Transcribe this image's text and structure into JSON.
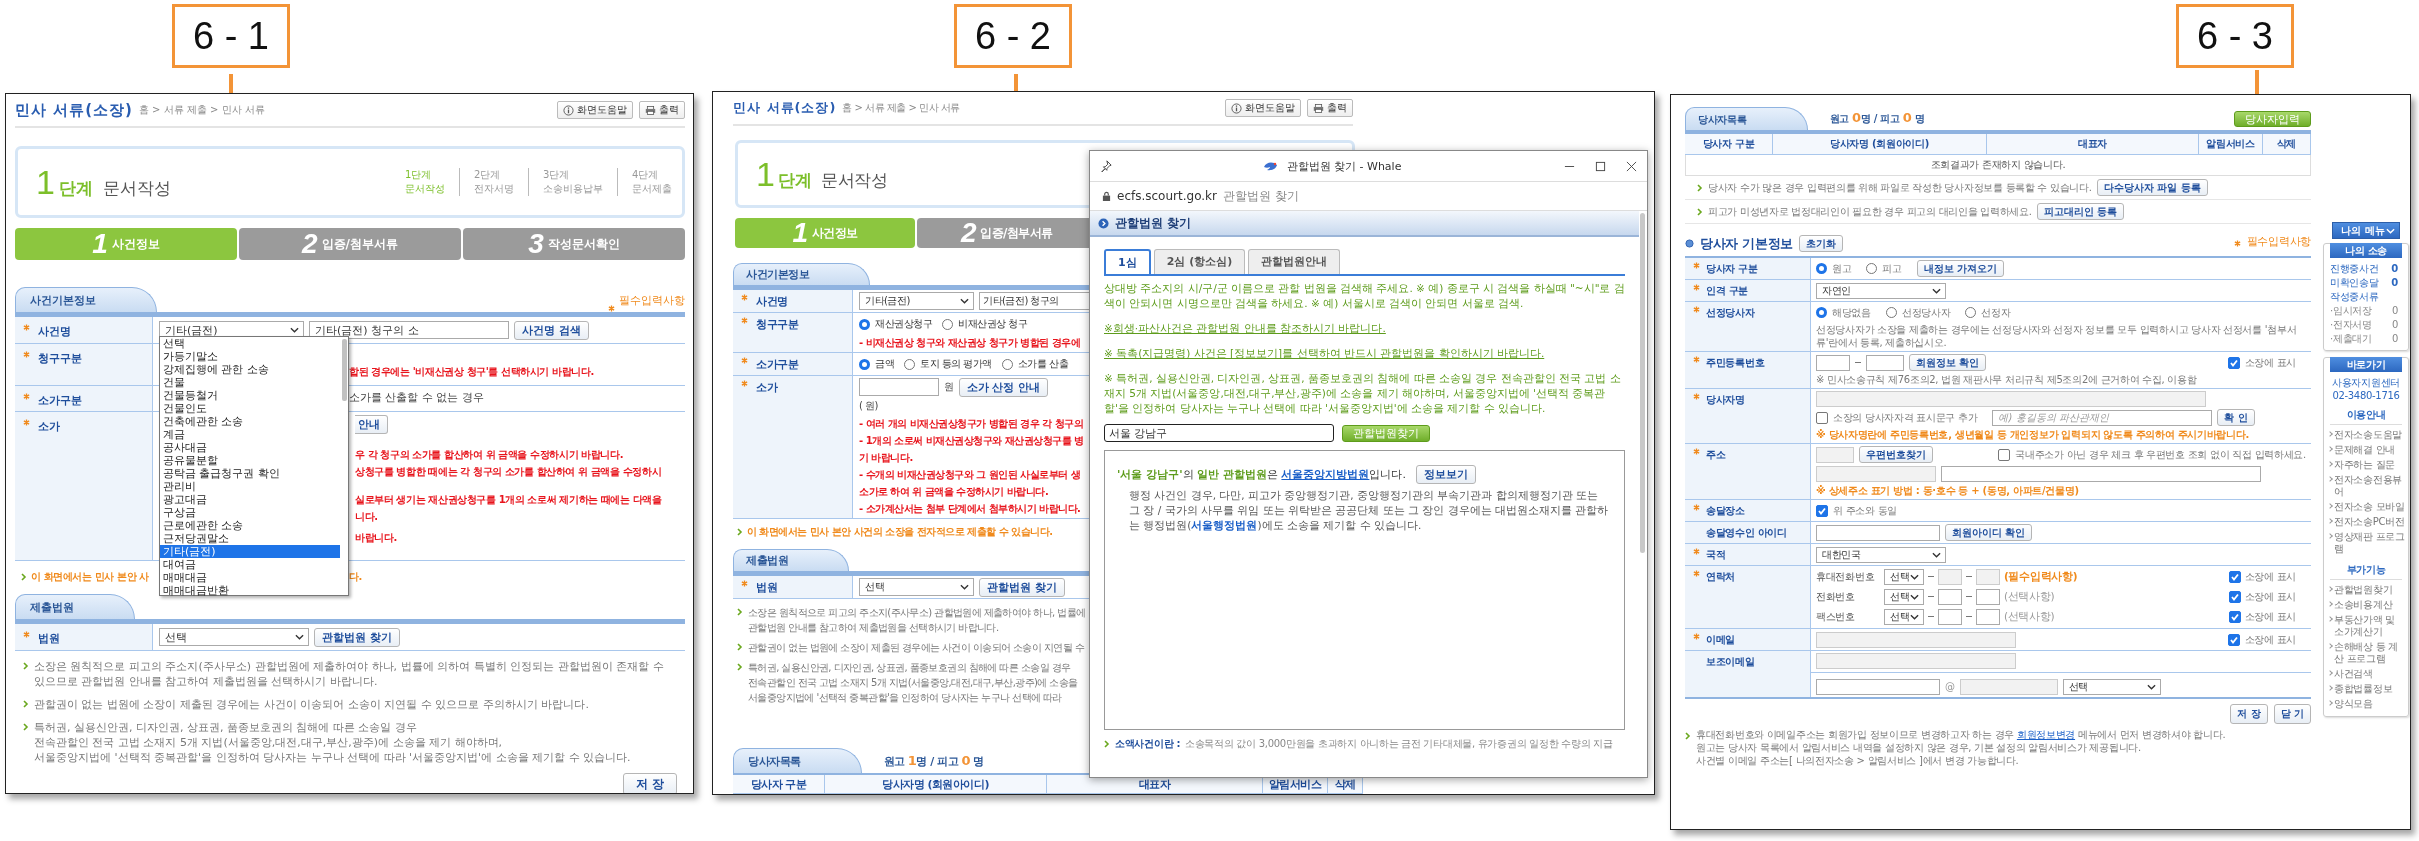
{
  "callouts": [
    {
      "label": "6 - 1"
    },
    {
      "label": "6 - 2"
    },
    {
      "label": "6 - 3"
    }
  ],
  "screen_1": {
    "header": {
      "title": "민사 서류(소장)",
      "breadcrumb": "홈 > 서류 제출 > 민사 서류",
      "help_button": "화면도움말",
      "print_button": "출력"
    },
    "stage": {
      "number": "1",
      "unit": "단계",
      "name": "문서작성"
    },
    "stages": [
      {
        "step": "1단계",
        "name": "문서작성",
        "selected": true
      },
      {
        "step": "2단계",
        "name": "전자서명",
        "selected": false
      },
      {
        "step": "3단계",
        "name": "소송비용납부",
        "selected": false
      },
      {
        "step": "4단계",
        "name": "문서제출",
        "selected": false
      }
    ],
    "tabs": [
      {
        "number": "1",
        "label": "사건정보",
        "selected": true
      },
      {
        "number": "2",
        "label": "입증/첨부서류",
        "selected": false
      },
      {
        "number": "3",
        "label": "작성문서확인",
        "selected": false
      }
    ],
    "case_section": {
      "title": "사건기본정보",
      "required_note": "필수입력사항"
    },
    "case_name": {
      "label": "사건명",
      "select": "기타(금전)",
      "value": "기타(금전) 청구의 소",
      "button": "사건명 검색"
    },
    "claim_type": {
      "label": "청구구분",
      "warning": "합된 경우에는 '비재산권상 청구'를 선택하시기 바랍니다."
    },
    "value_type": {
      "label": "소가구분",
      "option": "소가를 산출할 수 없는 경우"
    },
    "claim_value": {
      "label": "소가",
      "button": "안내",
      "warnings": [
        "우 각 청구의 소가를 합산하여 위 금액을 수정하시기 바랍니다.",
        "상청구를 병합한 때에는 각 청구의 소가를 합산하여 위 금액을 수정하시",
        "실로부터 생기는 재산권상청구를 1개의 소로써 제기하는 때에는 다액을",
        "니다.",
        "바랍니다."
      ]
    },
    "notice": [
      "이 화면에서는 민사 본안 사",
      "다."
    ],
    "case_type_list": [
      {
        "label": "선택",
        "selected": false
      },
      {
        "label": "가등기말소",
        "selected": false
      },
      {
        "label": "강제집행에 관한 소송",
        "selected": false
      },
      {
        "label": "건물",
        "selected": false
      },
      {
        "label": "건물등철거",
        "selected": false
      },
      {
        "label": "건물인도",
        "selected": false
      },
      {
        "label": "건축에관한 소송",
        "selected": false
      },
      {
        "label": "계금",
        "selected": false
      },
      {
        "label": "공사대금",
        "selected": false
      },
      {
        "label": "공유물분할",
        "selected": false
      },
      {
        "label": "공탁금 출급청구권 확인",
        "selected": false
      },
      {
        "label": "관리비",
        "selected": false
      },
      {
        "label": "광고대금",
        "selected": false
      },
      {
        "label": "구상금",
        "selected": false
      },
      {
        "label": "근로에관한 소송",
        "selected": false
      },
      {
        "label": "근저당권말소",
        "selected": false
      },
      {
        "label": "기타(금전)",
        "selected": true
      },
      {
        "label": "대여금",
        "selected": false
      },
      {
        "label": "매매대금",
        "selected": false
      },
      {
        "label": "매매대금반환",
        "selected": false
      }
    ],
    "court_section": {
      "title": "제출법원"
    },
    "court": {
      "label": "법원",
      "select": "선택",
      "button": "관할법원 찾기"
    },
    "notes": [
      {
        "lines": [
          "소장은 원칙적으로 피고의 주소지(주사무소) 관할법원에 제출하여야 하나, 법률에 의하여 특별히 인정되는 관할법원이 존재할 수 있으므로 관할법원 안내를 참고하여 제출법원을 선택하시기 바랍니다."
        ]
      },
      {
        "lines": [
          "관할권이 없는 법원에 소장이 제출된 경우에는 사건이 이송되어 소송이 지연될 수 있으므로 주의하시기 바랍니다."
        ]
      },
      {
        "lines": [
          "특허권, 실용신안권, 디자인권, 상표권, 품종보호권의 침해에 따른 소송일 경우",
          "전속관할인 전국 고법 소재지 5개 지법(서울중앙,대전,대구,부산,광주)에 소송을 제기 해야하며,",
          "서울중앙지법에 '선택적 중복관할'을 인정하여 당사자는 누구나 선택에 따라 '서울중앙지법'에 소송을 제기할 수 있습니다."
        ]
      }
    ],
    "save_button": "저 장"
  },
  "screen_2": {
    "header": {
      "title": "민사 서류(소장)",
      "breadcrumb": "홈 > 서류 제출 > 민사 서류",
      "help_button": "화면도움말",
      "print_button": "출력"
    },
    "stage": {
      "number": "1",
      "unit": "단계",
      "name": "문서작성"
    },
    "tabs": [
      {
        "number": "1",
        "label": "사건정보",
        "selected": true
      },
      {
        "number": "2",
        "label": "입증/첨부서류",
        "selected": false
      }
    ],
    "case_section": {
      "title": "사건기본정보"
    },
    "case_name": {
      "label": "사건명",
      "select": "기타(금전)",
      "value": "기타(금전) 청구의"
    },
    "claim_type": {
      "label": "청구구분",
      "options": [
        {
          "label": "재산권상청구",
          "selected": true
        },
        {
          "label": "비재산권상 청구",
          "selected": false
        }
      ],
      "warning": "- 비재산권상 청구와 재산권상 청구가 병합된 경우에"
    },
    "value_type": {
      "label": "소가구분",
      "options": [
        {
          "label": "금액",
          "selected": true
        },
        {
          "label": "토지 등의 평가액",
          "selected": false
        },
        {
          "label": "소가를 산출",
          "selected": false
        }
      ]
    },
    "claim_value": {
      "label": "소가",
      "unit": "원",
      "button": "소가 산정 안내",
      "amount": "( 원)",
      "warnings": [
        "- 여러 개의 비재산권상청구가 병합된 경우 각 청구의",
        "- 1개의 소로써 비재산권상청구와 재산권상청구를 병",
        "기 바랍니다.",
        "- 수개의 비재산권상청구와 그 원인된 사실로부터 생",
        "소가로 하여 위 금액을 수정하시기 바랍니다.",
        "- 소가계산서는 첨부 단계에서 첨부하시기 바랍니다."
      ]
    },
    "notice": "이 화면에서는 민사 본안 사건의 소장을 전자적으로 제출할 수 있습니다.",
    "court_section": {
      "title": "제출법원"
    },
    "court": {
      "label": "법원",
      "select": "선택",
      "button": "관할법원 찾기"
    },
    "notes": [
      {
        "lines": [
          "소장은 원칙적으로 피고의 주소지(주사무소) 관할법원에 제출하여야 하나, 법률에",
          "관할법원 안내를 참고하여 제출법원을 선택하시기 바랍니다."
        ]
      },
      {
        "lines": [
          "관할권이 없는 법원에 소장이 제출된 경우에는 사건이 이송되어 소송이 지연될 수"
        ]
      },
      {
        "lines": [
          "특허권, 실용신안권, 디자인권, 상표권, 품종보호권의 침해에 따른 소송일 경우",
          "전속관할인 전국 고법 소재지 5개 지법(서울중앙,대전,대구,부산,광주)에 소송을",
          "서울중앙지법에 '선택적 중복관할'을 인정하여 당사자는 누구나 선택에 따라"
        ]
      }
    ],
    "party_section": {
      "title": "당사자목록",
      "counts": "원고 **1**명 / 피고 **0** 명"
    },
    "party_columns": [
      "당사자 구분",
      "당사자명 (회원아이디)",
      "대표자",
      "알림서비스",
      "삭제"
    ],
    "popup": {
      "window_title": "관할법원 찾기 - Whale",
      "domain": "ecfs.scourt.go.kr",
      "page_title": "관할법원 찾기",
      "heading": "관할법원 찾기",
      "tabs": [
        {
          "label": "1심",
          "selected": true
        },
        {
          "label": "2심 (항소심)",
          "selected": false
        },
        {
          "label": "관할법원안내",
          "selected": false
        }
      ],
      "guide": "상대방 주소지의 시/구/군 이름으로 관할 법원을 검색해 주세요. ※ 예) 종로구 시 검색을 하실때 \"~시\"로 검색이 안되시면 시명으로만 검색을 하세요. ※ 예) 서울시로 검색이 안되면 서울로 검색.",
      "links": [
        "※회생·파산사건은 관할법원 안내를 참조하시기 바랍니다.",
        "※ 독촉(지급명령) 사건은 [정보보기]를 선택하여 반드시 관할법원을 확인하시기 바랍니다."
      ],
      "ip_note": "※ 특허권, 실용신안권, 디자인권, 상표권, 품종보호권의 침해에 따른 소송일 경우 전속관할인 전국 고법 소재지 5개 지법(서울중앙,대전,대구,부산,광주)에 소송을 제기 해야하며, 서울중앙지법에 '선택적 중복관할'을 인정하여 당사자는 누구나 선택에 따라 '서울중앙지법'에 소송을 제기할 수 있습니다.",
      "search_value": "서울 강남구",
      "search_button": "관할법원찾기",
      "result": {
        "text": "**'서울 강남구'**의 **일반 관할법원**은 ",
        "court": "서울중앙지방법원",
        "suffix": "입니다.",
        "info_button": "정보보기",
        "admin_note": "행정 사건인 경우, 다만, 피고가 중앙행정기관, 중앙행정기관의 부속기관과 합의제행정기관 또는 그 장 / 국가의 사무를 위임 또는 위탁받은 공공단체 또는 그 장인 경우에는 대법원소재지를 관할하는 행정법원(**서울행정법원**)에도 소송을 제기할 수 있습니다."
      },
      "footer": {
        "term": "소액사건이란 :",
        "text": "소송목적의 값이 3,000만원을 초과하지 아니하는 금전 기타대체물, 유가증권의 일정한 수량의 지급"
      }
    }
  },
  "screen_3": {
    "party_section": {
      "title": "당사자목록",
      "counts": "원고 **0**명 / 피고 **0** 명",
      "add_button": "당사자입력"
    },
    "party_columns": [
      "당사자 구분",
      "당사자명 (회원아이디)",
      "대표자",
      "알림서비스",
      "삭제"
    ],
    "empty_message": "조회결과가 존재하지 않습니다.",
    "party_notes": [
      {
        "text": "당사자 수가 많은 경우 입력편의를 위해 파일로 작성한 당사자정보를 등록할 수 있습니다.",
        "button": "다수당사자 파일 등록"
      },
      {
        "text": "피고가 미성년자로 법정대리인이 필요한 경우 피고의 대리인을 입력하세요.",
        "button": "피고대리인 등록"
      }
    ],
    "basic": {
      "title": "당사자 기본정보",
      "reset_button": "초기화",
      "required_note": "필수입력사항"
    },
    "party_type": {
      "label": "당사자 구분",
      "required": true,
      "options": [
        {
          "label": "원고",
          "selected": true
        },
        {
          "label": "피고",
          "selected": false
        }
      ],
      "button": "내정보 가져오기"
    },
    "person_type": {
      "label": "인격 구분",
      "required": true,
      "select": "자연인"
    },
    "representative": {
      "label": "선정당사자",
      "required": true,
      "options": [
        {
          "label": "해당없음",
          "selected": true
        },
        {
          "label": "선정당사자",
          "selected": false
        },
        {
          "label": "선정자",
          "selected": false
        }
      ],
      "help": "선정당사자가 소장을 제출하는 경우에는 선정당사자와 선정자 정보를 모두 입력하시고 당사자 선정서를 '첨부서류'란에서 등록, 제출하십시오."
    },
    "resident_number": {
      "label": "주민등록번호",
      "required": true,
      "button": "회원정보 확인",
      "show": {
        "label": "소장에 표시",
        "checked": true
      },
      "help": "※ 민사소송규칙 제76조의2, 법원 재판사무 처리규칙 제5조의2에 근거하여 수집, 이용함"
    },
    "party_name": {
      "label": "당사자명",
      "required": true,
      "qualifier": {
        "label": "소장의 당사자자격 표시문구 추가",
        "checked": false
      },
      "placeholder": "예) 홍길동의 파산관재인",
      "button": "확 인",
      "warning": "※ 당사자명란에 주민등록번호, 생년월일 등 개인정보가 입력되지 않도록 주의하여 주시기바랍니다."
    },
    "address": {
      "label": "주소",
      "required": true,
      "button": "우편번호찾기",
      "foreign": {
        "label": "국내주소가 아닌 경우 체크 후 우편번호 조회 없이 직접 입력하세요.",
        "checked": false
      },
      "warning": "※ 상세주소 표기 방법 : 동·호수 등 + (동명, 아파트/건물명)"
    },
    "delivery_place": {
      "label": "송달장소",
      "required": true,
      "same": {
        "label": "위 주소와 동일",
        "checked": true
      }
    },
    "delivery_agent": {
      "label": "송달영수인 아이디",
      "required": false,
      "button": "회원아이디 확인"
    },
    "nationality": {
      "label": "국적",
      "required": true,
      "select": "대한민국"
    },
    "contact": {
      "label": "연락처",
      "required": true,
      "lines": [
        {
          "label": "휴대전화번호",
          "select": "선택",
          "hint": "(필수입력사항)",
          "mandatory": true,
          "show": {
            "label": "소장에 표시",
            "checked": true
          }
        },
        {
          "label": "전화번호",
          "select": "선택",
          "hint": "(선택사항)",
          "mandatory": false,
          "show": {
            "label": "소장에 표시",
            "checked": true
          }
        },
        {
          "label": "팩스번호",
          "select": "선택",
          "hint": "(선택사항)",
          "mandatory": false,
          "show": {
            "label": "소장에 표시",
            "checked": true
          }
        }
      ]
    },
    "email": {
      "label": "이메일",
      "required": true,
      "show": {
        "label": "소장에 표시",
        "checked": true
      }
    },
    "sub_email": {
      "label": "보조이메일",
      "required": false,
      "at": "@",
      "select": "선택"
    },
    "save_button": "저 장",
    "close_button": "닫 기",
    "notes": {
      "link_before": "휴대전화번호와 이메일주소는 회원가입 정보이므로 변경하고자 하는 경우 ",
      "link": "회원정보변경",
      "link_after": " 메뉴에서 먼저 변경하셔야 합니다.",
      "lines": [
        "원고는 당사자 목록에서 알림서비스 내역을 설정하지 않은 경우, 기본 설정의 알림서비스가 제공됩니다.",
        "사건별 이메일 주소는[ 나의전자소송 > 알림서비스 ]에서 변경 가능합니다."
      ]
    },
    "sidebar": {
      "menu_button": "나의 메뉴",
      "my_cases": {
        "title": "나의 소송",
        "items": [
          {
            "label": "진행중사건",
            "count": "0",
            "kind": "link"
          },
          {
            "label": "미확인송달",
            "count": "0",
            "kind": "link"
          },
          {
            "label": "작성중서류",
            "kind": "link"
          },
          {
            "label": "·임시저장",
            "count": "0",
            "kind": "sub"
          },
          {
            "label": "·전자서명",
            "count": "0",
            "kind": "sub"
          },
          {
            "label": "·제출대기",
            "count": "0",
            "kind": "sub"
          }
        ]
      },
      "shortcuts": {
        "title": "바로가기",
        "support": "사용자지원센터",
        "phone": "02-3480-1716",
        "guide_title": "이용안내",
        "guide_links": [
          "전자소송도움말",
          "문제해결 안내",
          "자주하는 질문",
          "전자소송전용뷰어",
          "전자소송 모바일",
          "전자소송PC버전",
          "영상재판 프로그램"
        ],
        "extra_title": "부가기능",
        "extra_links": [
          "관할법원찾기",
          "소송비용계산",
          "부동산가액 및 소가계산기",
          "손해배상 등 계산 프로그램",
          "사건검색",
          "종합법률정보",
          "양식모음"
        ]
      }
    }
  }
}
